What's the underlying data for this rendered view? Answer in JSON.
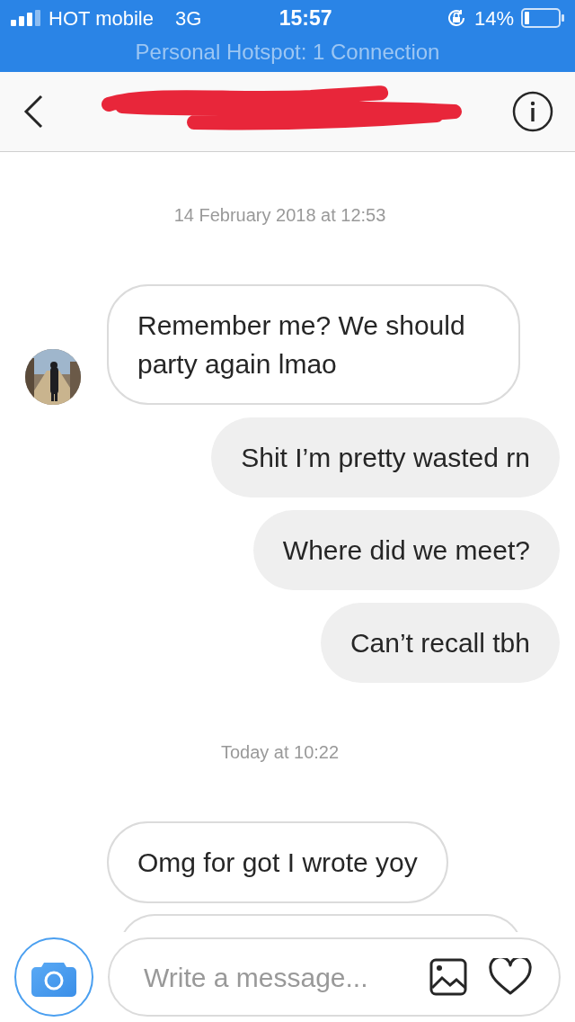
{
  "status_bar": {
    "carrier": "HOT mobile",
    "network": "3G",
    "time": "15:57",
    "battery": "14%",
    "hotspot": "Personal Hotspot: 1 Connection"
  },
  "header": {
    "name_redacted": true
  },
  "thread": [
    {
      "kind": "timestamp",
      "text": "14 February 2018 at 12:53"
    },
    {
      "kind": "incoming",
      "text": "Remember me? We should party again lmao",
      "avatar": true
    },
    {
      "kind": "outgoing",
      "text": "Shit I’m pretty wasted rn"
    },
    {
      "kind": "outgoing",
      "text": "Where did we meet?"
    },
    {
      "kind": "outgoing",
      "text": "Can’t recall tbh"
    },
    {
      "kind": "timestamp",
      "text": "Today at 10:22"
    },
    {
      "kind": "incoming",
      "text": "Omg for got I wrote yoy",
      "avatar": false
    },
    {
      "kind": "cut-off"
    }
  ],
  "composer": {
    "placeholder": "Write a message..."
  }
}
